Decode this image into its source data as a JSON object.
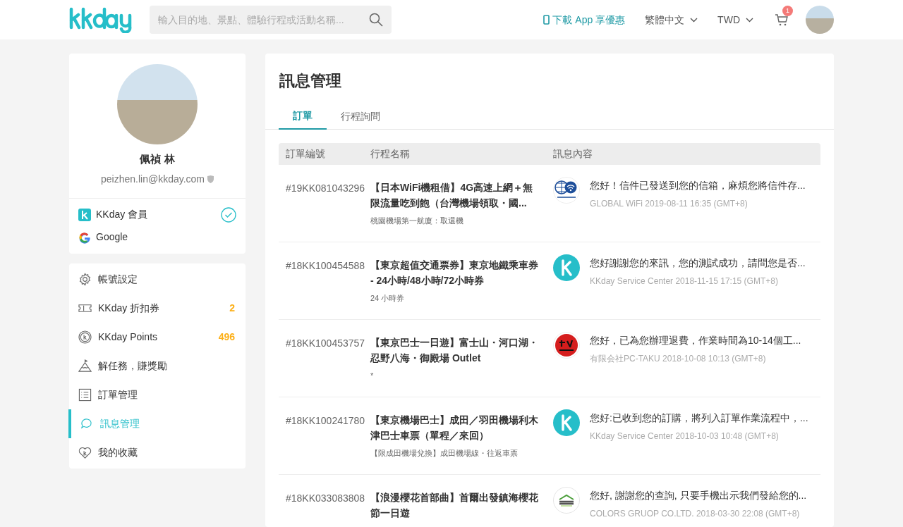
{
  "header": {
    "search": {
      "placeholder": "輸入目的地、景點、體驗行程或活動名稱..."
    },
    "app_link": "下載 App 享優惠",
    "language": "繁體中文",
    "currency": "TWD",
    "cart_count": "1"
  },
  "profile": {
    "name": "佩禎 林",
    "email": "peizhen.lin@kkday.com",
    "accounts": [
      {
        "kind": "kkday",
        "label": "KKday 會員",
        "verified": true
      },
      {
        "kind": "google",
        "label": "Google",
        "verified": false
      }
    ]
  },
  "menu": [
    {
      "kind": "gear",
      "label": "帳號設定",
      "selected": false
    },
    {
      "kind": "ticket",
      "label": "KKday 折扣券",
      "count": "2",
      "selected": false
    },
    {
      "kind": "coin",
      "label": "KKday Points",
      "count": "496",
      "selected": false
    },
    {
      "kind": "mountain",
      "label": "解任務，賺獎勵",
      "selected": false
    },
    {
      "kind": "list",
      "label": "訂單管理",
      "selected": false
    },
    {
      "kind": "chat",
      "label": "訊息管理",
      "selected": true
    },
    {
      "kind": "heart",
      "label": "我的收藏",
      "selected": false
    }
  ],
  "page_title": "訊息管理",
  "tabs": [
    {
      "label": "訂單",
      "selected": true
    },
    {
      "label": "行程詢問",
      "selected": false
    }
  ],
  "table": {
    "columns": [
      "訂單編號",
      "行程名稱",
      "訊息內容"
    ],
    "rows": [
      {
        "order_no": "#19KK081043296",
        "product": "【日本WiFi機租借】4G高速上網＋無限流量吃到飽（台灣機場領取・國...",
        "option": "桃園機場第一航廈：取還機",
        "kind": "wifi",
        "message": "您好！信件已發送到您的信箱，麻煩您將信件存...",
        "meta": "GLOBAL WiFi 2019-08-11 16:35 (GMT+8)"
      },
      {
        "order_no": "#18KK100454588",
        "product": "【東京超值交通票券】東京地鐵乘車券 - 24小時/48小時/72小時券",
        "option": "24 小時券",
        "kind": "kkday",
        "message": "您好謝謝您的來訊，您的測試成功，請問您是否...",
        "meta": "KKday Service Center 2018-11-15 17:15 (GMT+8)"
      },
      {
        "order_no": "#18KK100453757",
        "product": "【東京巴士一日遊】富士山・河口湖・忍野八海・御殿場 Outlet",
        "option": "*",
        "kind": "calligraphy",
        "message": "您好，已為您辦理退費，作業時間為10-14個工...",
        "meta": "有限会社PC-TAKU 2018-10-08 10:13 (GMT+8)"
      },
      {
        "order_no": "#18KK100241780",
        "product": "【東京機場巴士】成田／羽田機場利木津巴士車票（單程／來回）",
        "option": "【限成田機場兌換】成田機場線・往返車票",
        "kind": "kkday",
        "message": "您好:已收到您的訂購，將列入訂單作業流程中，...",
        "meta": "KKday Service Center 2018-10-03 10:48 (GMT+8)"
      },
      {
        "order_no": "#18KK033083808",
        "product": "【浪漫櫻花首部曲】首爾出發鎮海櫻花節一日遊",
        "kind": "tour",
        "message": "您好, 謝謝您的查詢, 只要手機出示我們發給您的...",
        "meta": "COLORS GRUOP CO.LTD. 2018-03-30 22:08 (GMT+8)"
      }
    ]
  }
}
